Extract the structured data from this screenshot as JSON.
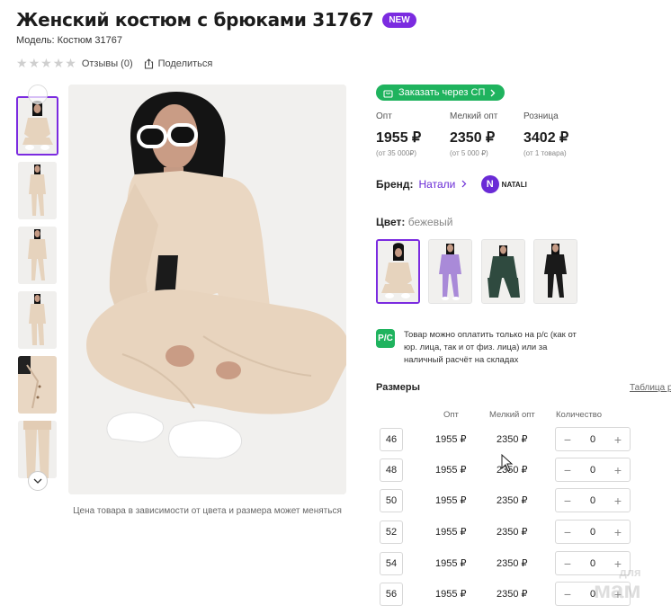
{
  "product": {
    "title": "Женский костюм с брюками 31767",
    "badge": "NEW",
    "model": "Модель: Костюм 31767",
    "reviews": "Отзывы (0)",
    "share": "Поделиться"
  },
  "gallery": {
    "note": "Цена товара в зависимости от цвета и размера может меняться",
    "thumbnails": [
      "beige-front",
      "beige-standing",
      "beige-standing",
      "beige-standing",
      "beige-closeup",
      "beige-pants"
    ]
  },
  "order_button": "Заказать через СП",
  "prices": [
    {
      "label": "Опт",
      "value": "1955 ₽",
      "sub": "(от 35 000₽)"
    },
    {
      "label": "Мелкий опт",
      "value": "2350 ₽",
      "sub": "(от 5 000 ₽)"
    },
    {
      "label": "Розница",
      "value": "3402 ₽",
      "sub": "(от 1 товара)"
    }
  ],
  "brand": {
    "label": "Бренд:",
    "name": "Натали",
    "logo_letter": "N",
    "logo_text": "NATALI"
  },
  "color": {
    "label": "Цвет:",
    "value": "бежевый",
    "swatches": [
      "бежевый",
      "лавандовый",
      "тёмно-зелёный",
      "чёрный"
    ]
  },
  "payment_note": "Товар можно оплатить только на р/с (как от юр. лица, так и от физ. лица) или за наличный расчёт на складах",
  "payment_icon": "Р/С",
  "sizes": {
    "title": "Размеры",
    "table_link": "Таблица р",
    "headers": {
      "opt": "Опт",
      "small_opt": "Мелкий опт",
      "qty": "Количество"
    },
    "rows": [
      {
        "size": "46",
        "opt": "1955 ₽",
        "small_opt": "2350 ₽",
        "qty": "0"
      },
      {
        "size": "48",
        "opt": "1955 ₽",
        "small_opt": "2350 ₽",
        "qty": "0"
      },
      {
        "size": "50",
        "opt": "1955 ₽",
        "small_opt": "2350 ₽",
        "qty": "0"
      },
      {
        "size": "52",
        "opt": "1955 ₽",
        "small_opt": "2350 ₽",
        "qty": "0"
      },
      {
        "size": "54",
        "opt": "1955 ₽",
        "small_opt": "2350 ₽",
        "qty": "0"
      },
      {
        "size": "56",
        "opt": "1955 ₽",
        "small_opt": "2350 ₽",
        "qty": "0"
      }
    ]
  },
  "watermark": {
    "line1": "для",
    "line2": "мам"
  },
  "colors": {
    "accent": "#7b2be0",
    "green": "#1fb35e",
    "link": "#6a2bd6"
  }
}
